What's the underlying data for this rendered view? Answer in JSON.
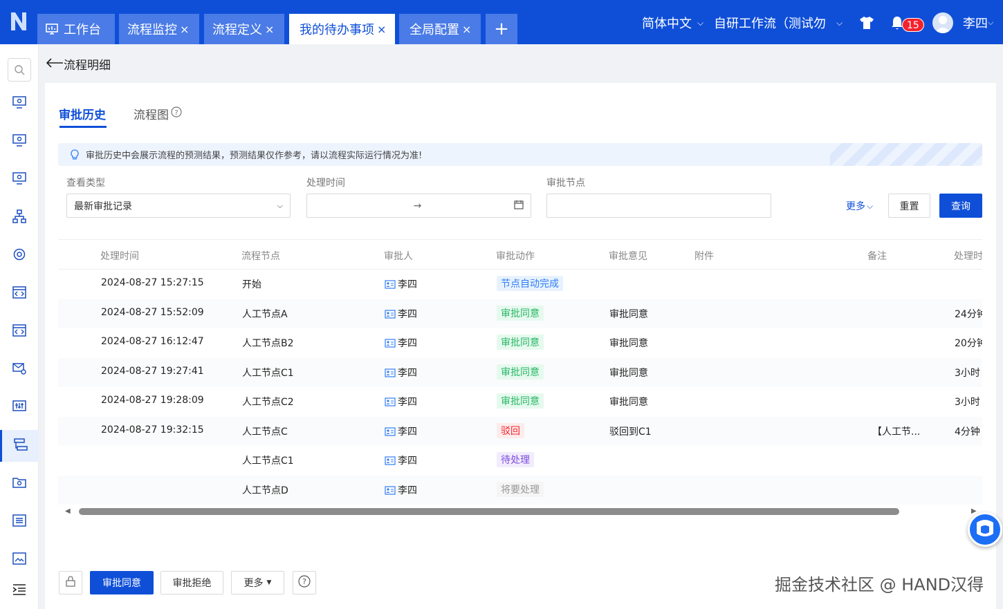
{
  "header": {
    "tabs": [
      {
        "label": "工作台"
      },
      {
        "label": "流程监控"
      },
      {
        "label": "流程定义"
      },
      {
        "label": "我的待办事项"
      },
      {
        "label": "全局配置"
      }
    ],
    "add": "+",
    "close": "×",
    "language": "简体中文",
    "tenant": "自研工作流（测试勿",
    "notifications": "15",
    "user": "李四"
  },
  "page": {
    "back_label": "流程明细"
  },
  "card": {
    "tabs": {
      "history": "审批历史",
      "flowchart": "流程图"
    },
    "notice": "审批历史中会展示流程的预测结果，预测结果仅作参考，请以流程实际运行情况为准!",
    "filters": {
      "view_type_label": "查看类型",
      "view_type_value": "最新审批记录",
      "time_label": "处理时间",
      "time_sep": "→",
      "node_label": "审批节点",
      "more": "更多",
      "reset": "重置",
      "query": "查询"
    },
    "table": {
      "headers": [
        "处理时间",
        "流程节点",
        "审批人",
        "审批动作",
        "审批意见",
        "附件",
        "备注",
        "处理时"
      ],
      "rows": [
        {
          "time": "2024-08-27 15:27:15",
          "node": "开始",
          "approver": "李四",
          "action": "节点自动完成",
          "opinion": "",
          "remark": "",
          "duration": ""
        },
        {
          "time": "2024-08-27 15:52:09",
          "node": "人工节点A",
          "approver": "李四",
          "action": "审批同意",
          "opinion": "审批同意",
          "remark": "",
          "duration": "24分钟"
        },
        {
          "time": "2024-08-27 16:12:47",
          "node": "人工节点B2",
          "approver": "李四",
          "action": "审批同意",
          "opinion": "审批同意",
          "remark": "",
          "duration": "20分钟"
        },
        {
          "time": "2024-08-27 19:27:41",
          "node": "人工节点C1",
          "approver": "李四",
          "action": "审批同意",
          "opinion": "审批同意",
          "remark": "",
          "duration": "3小时"
        },
        {
          "time": "2024-08-27 19:28:09",
          "node": "人工节点C2",
          "approver": "李四",
          "action": "审批同意",
          "opinion": "审批同意",
          "remark": "",
          "duration": "3小时"
        },
        {
          "time": "2024-08-27 19:32:15",
          "node": "人工节点C",
          "approver": "李四",
          "action": "驳回",
          "opinion": "驳回到C1",
          "remark": "【人工节...",
          "duration": "4分钟"
        },
        {
          "time": "",
          "node": "人工节点C1",
          "approver": "李四",
          "action": "待处理",
          "opinion": "",
          "remark": "",
          "duration": ""
        },
        {
          "time": "",
          "node": "人工节点D",
          "approver": "李四",
          "action": "将要处理",
          "opinion": "",
          "remark": "",
          "duration": ""
        }
      ]
    }
  },
  "footer": {
    "approve": "审批同意",
    "reject": "审批拒绝",
    "more": "更多"
  },
  "watermark": "掘金技术社区 @ HAND汉得",
  "colors": {
    "primary": "#0f4fd8"
  }
}
